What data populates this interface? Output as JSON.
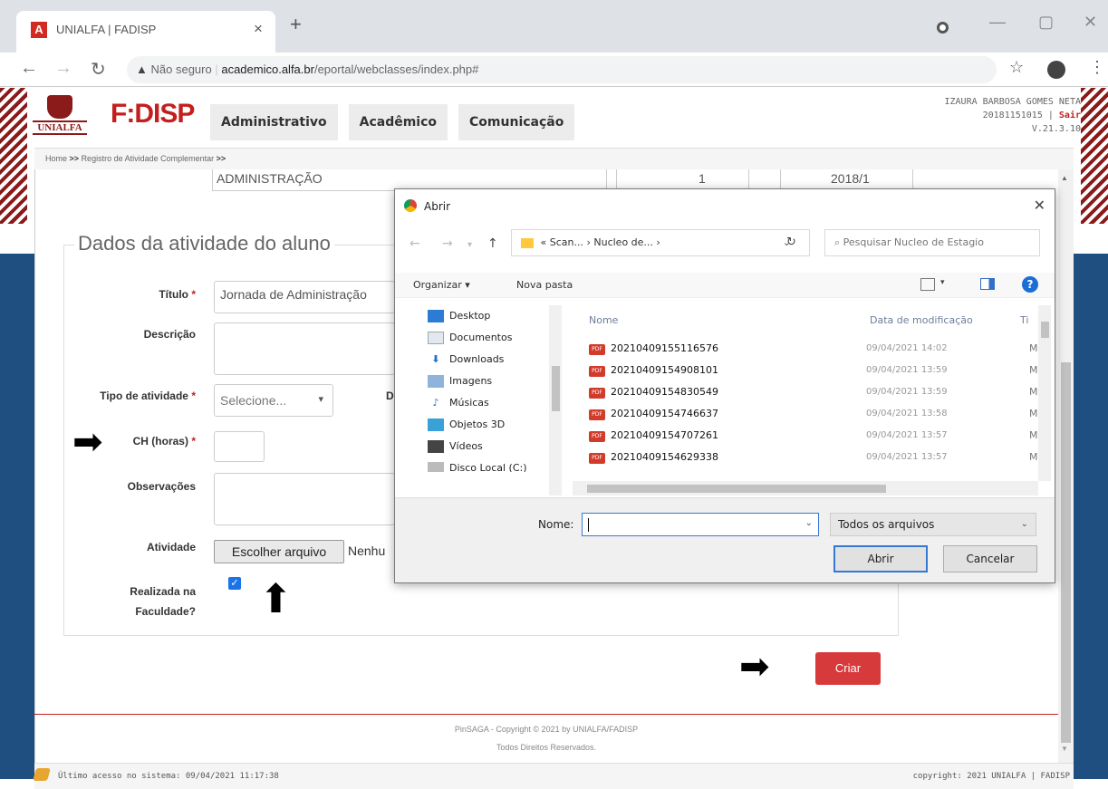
{
  "browser": {
    "tab_title": "UNIALFA | FADISP",
    "tab_favicon_letter": "A",
    "not_secure": "Não seguro",
    "url_domain": "academico.alfa.br",
    "url_path": "/eportal/webclasses/index.php#"
  },
  "header": {
    "logo_unialfa": "UNIALFA",
    "logo_fadisp": "F:DISP",
    "nav": [
      "Administrativo",
      "Acadêmico",
      "Comunicação"
    ],
    "user_name": "IZAURA BARBOSA GOMES NETA",
    "user_id": "20181151015",
    "logout": "Sair",
    "version": "V.21.3.10"
  },
  "breadcrumb": {
    "home": "Home",
    "separator": ">>",
    "current": "Registro de Atividade Complementar"
  },
  "top_row": {
    "course": "ADMINISTRAÇÃO",
    "value1": "1",
    "value2": "2018/1"
  },
  "form": {
    "legend": "Dados da atividade do aluno",
    "titulo_label": "Título",
    "titulo_value": "Jornada de Administração",
    "descricao_label": "Descrição",
    "tipo_label": "Tipo de atividade",
    "tipo_value": "Selecione...",
    "d_label": "D",
    "ch_label": "CH (horas)",
    "observacoes_label": "Observações",
    "atividade_label": "Atividade",
    "file_button": "Escolher arquivo",
    "file_status": "Nenhu",
    "realizada_label_1": "Realizada na",
    "realizada_label_2": "Faculdade?",
    "required_mark": "*",
    "criar_button": "Criar"
  },
  "footer": {
    "line1": "PinSAGA - Copyright © 2021 by UNIALFA/FADISP",
    "line2": "Todos Direitos Reservados.",
    "last_access": "Último acesso no sistema: 09/04/2021 11:17:38",
    "copyright": "copyright: 2021 UNIALFA | FADISP"
  },
  "dialog": {
    "title": "Abrir",
    "path_prefix": "«",
    "path_seg1": "Scan...",
    "path_seg2": "Nucleo de...",
    "path_sep": "›",
    "search_placeholder": "Pesquisar Nucleo de Estagio",
    "organizar": "Organizar",
    "nova_pasta": "Nova pasta",
    "nav_items": [
      "Desktop",
      "Documentos",
      "Downloads",
      "Imagens",
      "Músicas",
      "Objetos 3D",
      "Vídeos",
      "Disco Local (C:)"
    ],
    "col_name": "Nome",
    "col_date": "Data de modificação",
    "col_type": "Ti",
    "files": [
      {
        "name": "20210409155116576",
        "date": "09/04/2021 14:02",
        "type": "M"
      },
      {
        "name": "20210409154908101",
        "date": "09/04/2021 13:59",
        "type": "M"
      },
      {
        "name": "20210409154830549",
        "date": "09/04/2021 13:59",
        "type": "M"
      },
      {
        "name": "20210409154746637",
        "date": "09/04/2021 13:58",
        "type": "M"
      },
      {
        "name": "20210409154707261",
        "date": "09/04/2021 13:57",
        "type": "M"
      },
      {
        "name": "20210409154629338",
        "date": "09/04/2021 13:57",
        "type": "M"
      }
    ],
    "name_label": "Nome:",
    "name_value": "",
    "filter": "Todos os arquivos",
    "btn_open": "Abrir",
    "btn_cancel": "Cancelar"
  },
  "colors": {
    "brand_red": "#c41f1f",
    "side_blue": "#1f4f80",
    "criar_red": "#d63a3a",
    "dialog_accent": "#3578d4"
  }
}
